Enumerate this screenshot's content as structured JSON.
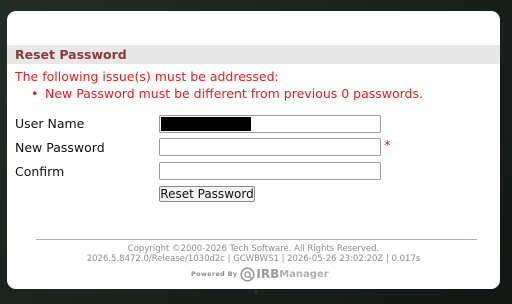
{
  "section": {
    "title": "Reset Password"
  },
  "errors": {
    "heading": "The following issue(s) must be addressed:",
    "items": [
      "New Password must be different from previous 0 passwords."
    ]
  },
  "form": {
    "username": {
      "label": "User Name",
      "value": ""
    },
    "new_password": {
      "label": "New Password",
      "value": "",
      "required_mark": "*"
    },
    "confirm": {
      "label": "Confirm",
      "value": ""
    },
    "submit_label": "Reset Password"
  },
  "footer": {
    "copyright": "Copyright ©2000-2026 Tech Software. All Rights Reserved.",
    "build_info": "2026.5.8472.0/Release/1030d2c | GCWBWS1 | 2026-05-26 23:02:20Z | 0.017s",
    "powered_by": "Powered By",
    "logo_irb": "IRB",
    "logo_manager": "Manager"
  },
  "colors": {
    "error": "#e1201e",
    "section_title": "#8a3b3b",
    "section_bg": "#e7e7e7",
    "divider": "#d7a39f",
    "footer_text": "#8c8c8c"
  }
}
